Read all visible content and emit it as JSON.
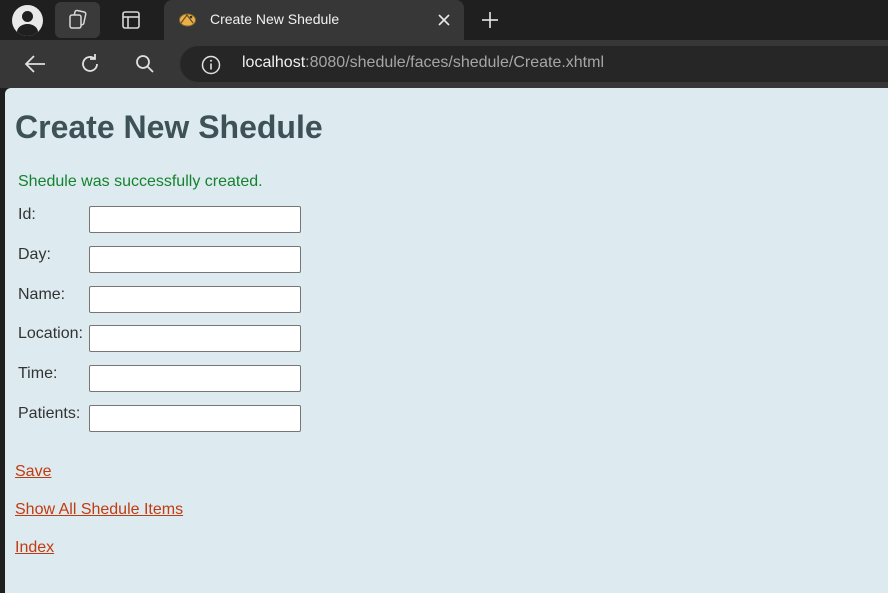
{
  "browser": {
    "tab": {
      "title": "Create New Shedule"
    },
    "address": {
      "host": "localhost",
      "rest": ":8080/shedule/faces/shedule/Create.xhtml"
    }
  },
  "page": {
    "heading": "Create New Shedule",
    "message": "Shedule was successfully created.",
    "fields": [
      {
        "label": "Id:",
        "value": ""
      },
      {
        "label": "Day:",
        "value": ""
      },
      {
        "label": "Name:",
        "value": ""
      },
      {
        "label": "Location:",
        "value": ""
      },
      {
        "label": "Time:",
        "value": ""
      },
      {
        "label": "Patients:",
        "value": ""
      }
    ],
    "links": {
      "save": "Save",
      "show_all": "Show All Shedule Items",
      "index": "Index"
    }
  },
  "colors": {
    "page_background": "#ddebf0",
    "heading": "#3d5156",
    "success_message": "#14822e",
    "link": "#c23a10"
  }
}
